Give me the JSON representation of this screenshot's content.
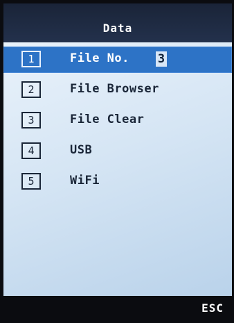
{
  "header": {
    "title": "Data"
  },
  "menu": {
    "items": [
      {
        "number": "1",
        "label": "File No.",
        "value": "3",
        "selected": true
      },
      {
        "number": "2",
        "label": "File Browser"
      },
      {
        "number": "3",
        "label": "File Clear"
      },
      {
        "number": "4",
        "label": "USB"
      },
      {
        "number": "5",
        "label": "WiFi"
      }
    ]
  },
  "footer": {
    "esc_label": "ESC"
  },
  "colors": {
    "header_bg": "#1a2438",
    "selection": "#2d73c6",
    "content_bg": "#d5e5f4"
  }
}
